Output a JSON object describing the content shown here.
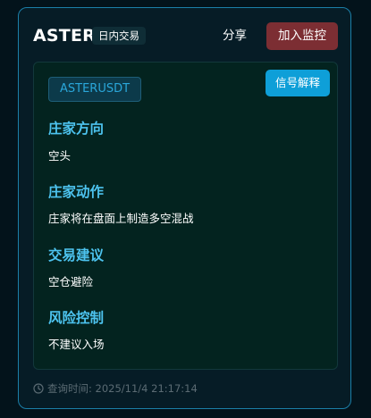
{
  "header": {
    "title": "ASTER",
    "tag": "日内交易",
    "share_label": "分享",
    "monitor_label": "加入监控"
  },
  "analysis": {
    "symbol": "ASTERUSDT",
    "signal_button": "信号解释",
    "sections": [
      {
        "heading": "庄家方向",
        "text": "空头"
      },
      {
        "heading": "庄家动作",
        "text": "庄家将在盘面上制造多空混战"
      },
      {
        "heading": "交易建议",
        "text": "空仓避险"
      },
      {
        "heading": "风险控制",
        "text": "不建议入场"
      }
    ]
  },
  "footer": {
    "icon": "clock-icon",
    "query_time": "查询时间: 2025/11/4 21:17:14"
  },
  "colors": {
    "background": "#03131b",
    "card_border": "#1b7fa8",
    "accent": "#4dc3ef",
    "monitor_button": "#7c2e33",
    "signal_button": "#0e9fd8"
  }
}
